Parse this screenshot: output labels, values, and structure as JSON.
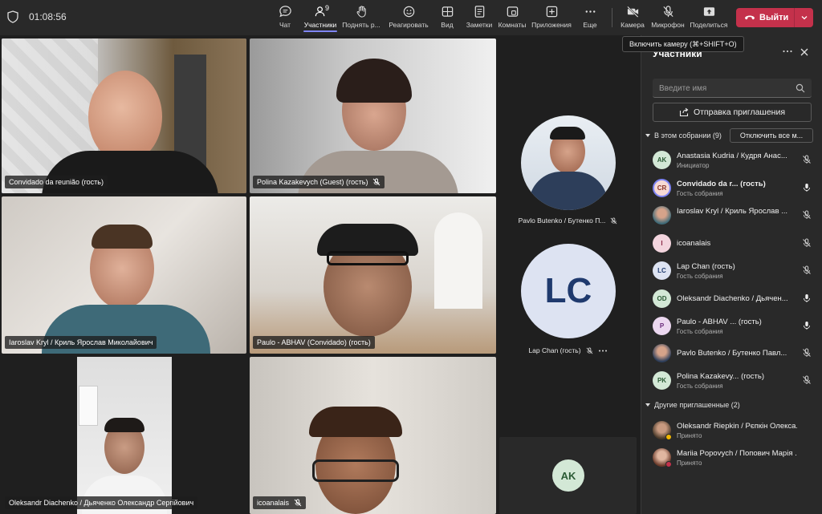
{
  "topbar": {
    "timer": "01:08:56",
    "participant_count": "9",
    "tools": [
      {
        "label": "Чат",
        "icon": "chat-icon"
      },
      {
        "label": "Участники",
        "icon": "people-icon"
      },
      {
        "label": "Поднять р...",
        "icon": "raise-hand-icon"
      },
      {
        "label": "Реагировать",
        "icon": "smile-icon"
      },
      {
        "label": "Вид",
        "icon": "view-icon"
      },
      {
        "label": "Заметки",
        "icon": "notes-icon"
      },
      {
        "label": "Комнаты",
        "icon": "rooms-icon"
      },
      {
        "label": "Приложения",
        "icon": "apps-icon"
      },
      {
        "label": "Еще",
        "icon": "more-icon"
      },
      {
        "label": "Камера",
        "icon": "camera-off-icon"
      },
      {
        "label": "Микрофон",
        "icon": "mic-off-icon"
      },
      {
        "label": "Поделиться",
        "icon": "share-icon"
      }
    ],
    "leave_label": "Выйти",
    "accent": "#7f85f5",
    "leave_color": "#c4314b"
  },
  "tooltip": "Включить камеру (⌘+SHIFT+O)",
  "grid": {
    "tiles": [
      {
        "name": "Convidado da reunião (гость)"
      },
      {
        "name": "Polina Kazakevych (Guest) (гость)"
      },
      {
        "name": "Iaroslav Kryl / Криль Ярослав Миколайович"
      },
      {
        "name": "Paulo - ABHAV (Convidado) (гость)"
      },
      {
        "name": "Oleksandr Diachenko / Дьяченко Олександр Сергійович"
      },
      {
        "name": "icoanalais"
      }
    ],
    "side": [
      {
        "name": "Pavlo Butenko / Бутенко П..."
      },
      {
        "initials": "LC",
        "name": "Lap Chan (гость)"
      },
      {
        "initials": "AK"
      }
    ]
  },
  "panel": {
    "title": "Участники",
    "search_placeholder": "Введите имя",
    "invite_label": "Отправка приглашения",
    "in_meeting_label": "В этом собрании (9)",
    "mute_all_label": "Отключить все м...",
    "others_label": "Другие приглашенные (2)",
    "people": [
      {
        "initials": "AK",
        "name": "Anastasia Kudria / Кудря Анас...",
        "role": "Инициатор",
        "color": "#d3e8d6",
        "mic": "off"
      },
      {
        "initials": "CR",
        "name": "Convidado da r... (гость)",
        "role": "Гость собрания",
        "color": "#f6d9d4",
        "mic": "on",
        "bold": true
      },
      {
        "initials": "",
        "name": "Iaroslav Kryl / Криль Ярослав ...",
        "role": "",
        "color": "#6a7a8a",
        "mic": "off"
      },
      {
        "initials": "I",
        "name": "icoanalais",
        "role": "",
        "color": "#f3d5de",
        "mic": "off"
      },
      {
        "initials": "LC",
        "name": "Lap Chan (гость)",
        "role": "Гость собрания",
        "color": "#dde3f2",
        "mic": "off"
      },
      {
        "initials": "OD",
        "name": "Oleksandr Diachenko / Дьячен...",
        "role": "",
        "color": "#d3e8d6",
        "mic": "on"
      },
      {
        "initials": "P",
        "name": "Paulo - ABHAV ...  (гость)",
        "role": "Гость собрания",
        "color": "#ecd8f0",
        "mic": "on"
      },
      {
        "initials": "",
        "name": "Pavlo Butenko / Бутенко Павл...",
        "role": "",
        "color": "#4a6688",
        "mic": "off"
      },
      {
        "initials": "PK",
        "name": "Polina Kazakevy... (гость)",
        "role": "Гость собрания",
        "color": "#d3e8d6",
        "mic": "off"
      }
    ],
    "others": [
      {
        "name": "Oleksandr Riepkin / Рєпкін Олекса...",
        "role": "Принято",
        "color": "#6a5a4a",
        "dot": "#f2b600"
      },
      {
        "name": "Mariia Popovych / Попович Марія ...",
        "role": "Принято",
        "color": "#b08070",
        "dot": "#c4314b"
      }
    ]
  }
}
